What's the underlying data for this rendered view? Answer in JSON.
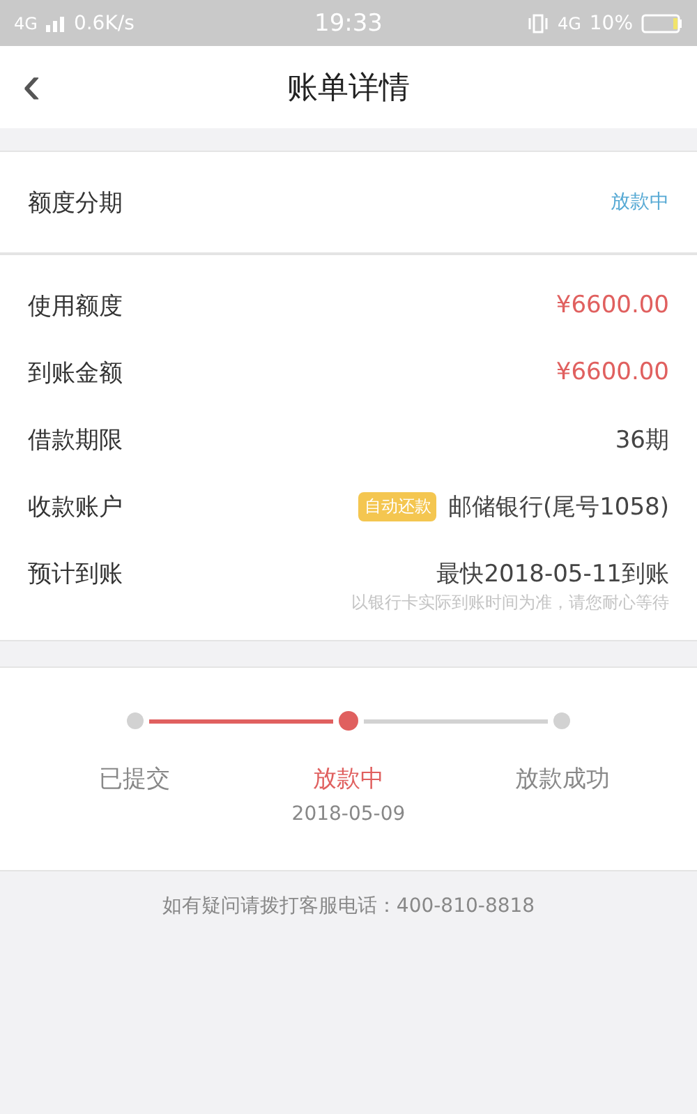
{
  "status_bar": {
    "network": "4G",
    "speed": "0.6K/s",
    "time": "19:33",
    "network_right": "4G",
    "battery": "10%"
  },
  "header": {
    "back": "‹",
    "title": "账单详情"
  },
  "plan": {
    "label": "额度分期",
    "status": "放款中"
  },
  "details": [
    {
      "label": "使用额度",
      "value": "¥6600.00",
      "kind": "amount"
    },
    {
      "label": "到账金额",
      "value": "¥6600.00",
      "kind": "amount"
    },
    {
      "label": "借款期限",
      "value": "36期",
      "kind": "plain"
    },
    {
      "label": "收款账户",
      "value": "邮储银行(尾号1058)",
      "badge": "自动还款",
      "kind": "plain"
    },
    {
      "label": "预计到账",
      "value": "最快2018-05-11到账",
      "note": "以银行卡实际到账时间为准，请您耐心等待",
      "kind": "plain"
    }
  ],
  "steps": [
    {
      "label": "已提交",
      "selected": false
    },
    {
      "label": "放款中",
      "date": "2018-05-09",
      "selected": true
    },
    {
      "label": "放款成功",
      "selected": false
    }
  ],
  "footer": "如有疑问请拨打客服电话：400-810-8818"
}
